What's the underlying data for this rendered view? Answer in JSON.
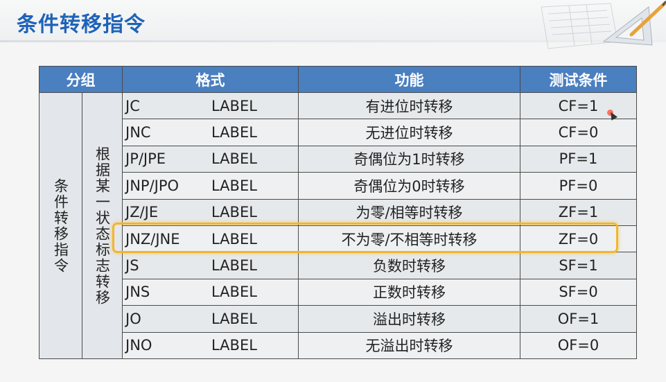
{
  "title": "条件转移指令",
  "table": {
    "headers": [
      "分组",
      "格式",
      "功能",
      "测试条件"
    ],
    "group_main": "条件转移指令",
    "group_sub": "根据某一状态标志转移",
    "rows": [
      {
        "mnemonic": "JC",
        "operand": "LABEL",
        "function": "有进位时转移",
        "condition": "CF=1"
      },
      {
        "mnemonic": "JNC",
        "operand": "LABEL",
        "function": "无进位时转移",
        "condition": "CF=0"
      },
      {
        "mnemonic": "JP/JPE",
        "operand": "LABEL",
        "function": "奇偶位为1时转移",
        "condition": "PF=1"
      },
      {
        "mnemonic": "JNP/JPO",
        "operand": "LABEL",
        "function": "奇偶位为0时转移",
        "condition": "PF=0"
      },
      {
        "mnemonic": "JZ/JE",
        "operand": "LABEL",
        "function": "为零/相等时转移",
        "condition": "ZF=1"
      },
      {
        "mnemonic": "JNZ/JNE",
        "operand": "LABEL",
        "function": "不为零/不相等时转移",
        "condition": "ZF=0"
      },
      {
        "mnemonic": "JS",
        "operand": "LABEL",
        "function": "负数时转移",
        "condition": "SF=1"
      },
      {
        "mnemonic": "JNS",
        "operand": "LABEL",
        "function": "正数时转移",
        "condition": "SF=0"
      },
      {
        "mnemonic": "JO",
        "operand": "LABEL",
        "function": "溢出时转移",
        "condition": "OF=1"
      },
      {
        "mnemonic": "JNO",
        "operand": "LABEL",
        "function": "无溢出时转移",
        "condition": "OF=0"
      }
    ],
    "highlighted_row": 5
  },
  "colors": {
    "title": "#1e63b8",
    "header_bg": "#4a7fc0",
    "highlight_border": "#f3b62a"
  }
}
